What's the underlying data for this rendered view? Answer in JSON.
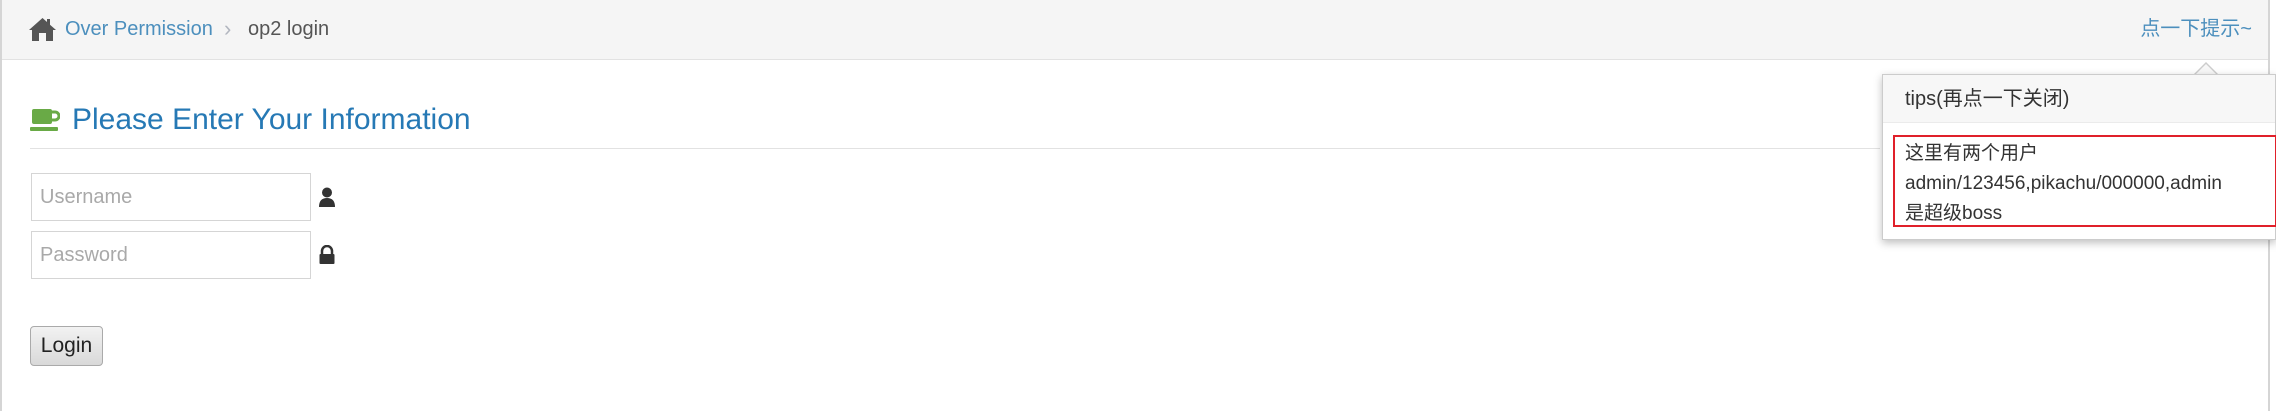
{
  "breadcrumb": {
    "parent": "Over Permission",
    "separator": "›",
    "current": "op2 login"
  },
  "hint": {
    "link_label": "点一下提示~"
  },
  "form": {
    "title": "Please Enter Your Information",
    "username_placeholder": "Username",
    "password_placeholder": "Password",
    "login_label": "Login"
  },
  "tips": {
    "title": "tips(再点一下关闭)",
    "lines": [
      "这里有两个用户",
      "admin/123456,pikachu/000000,admin",
      "是超级boss"
    ]
  },
  "icons": {
    "home": "home-icon",
    "coffee": "coffee-icon",
    "user": "user-icon",
    "lock": "lock-icon"
  },
  "colors": {
    "link": "#4c8fbd",
    "title": "#2679b5",
    "coffee": "#69aa46",
    "highlight_box": "#e0202a"
  }
}
